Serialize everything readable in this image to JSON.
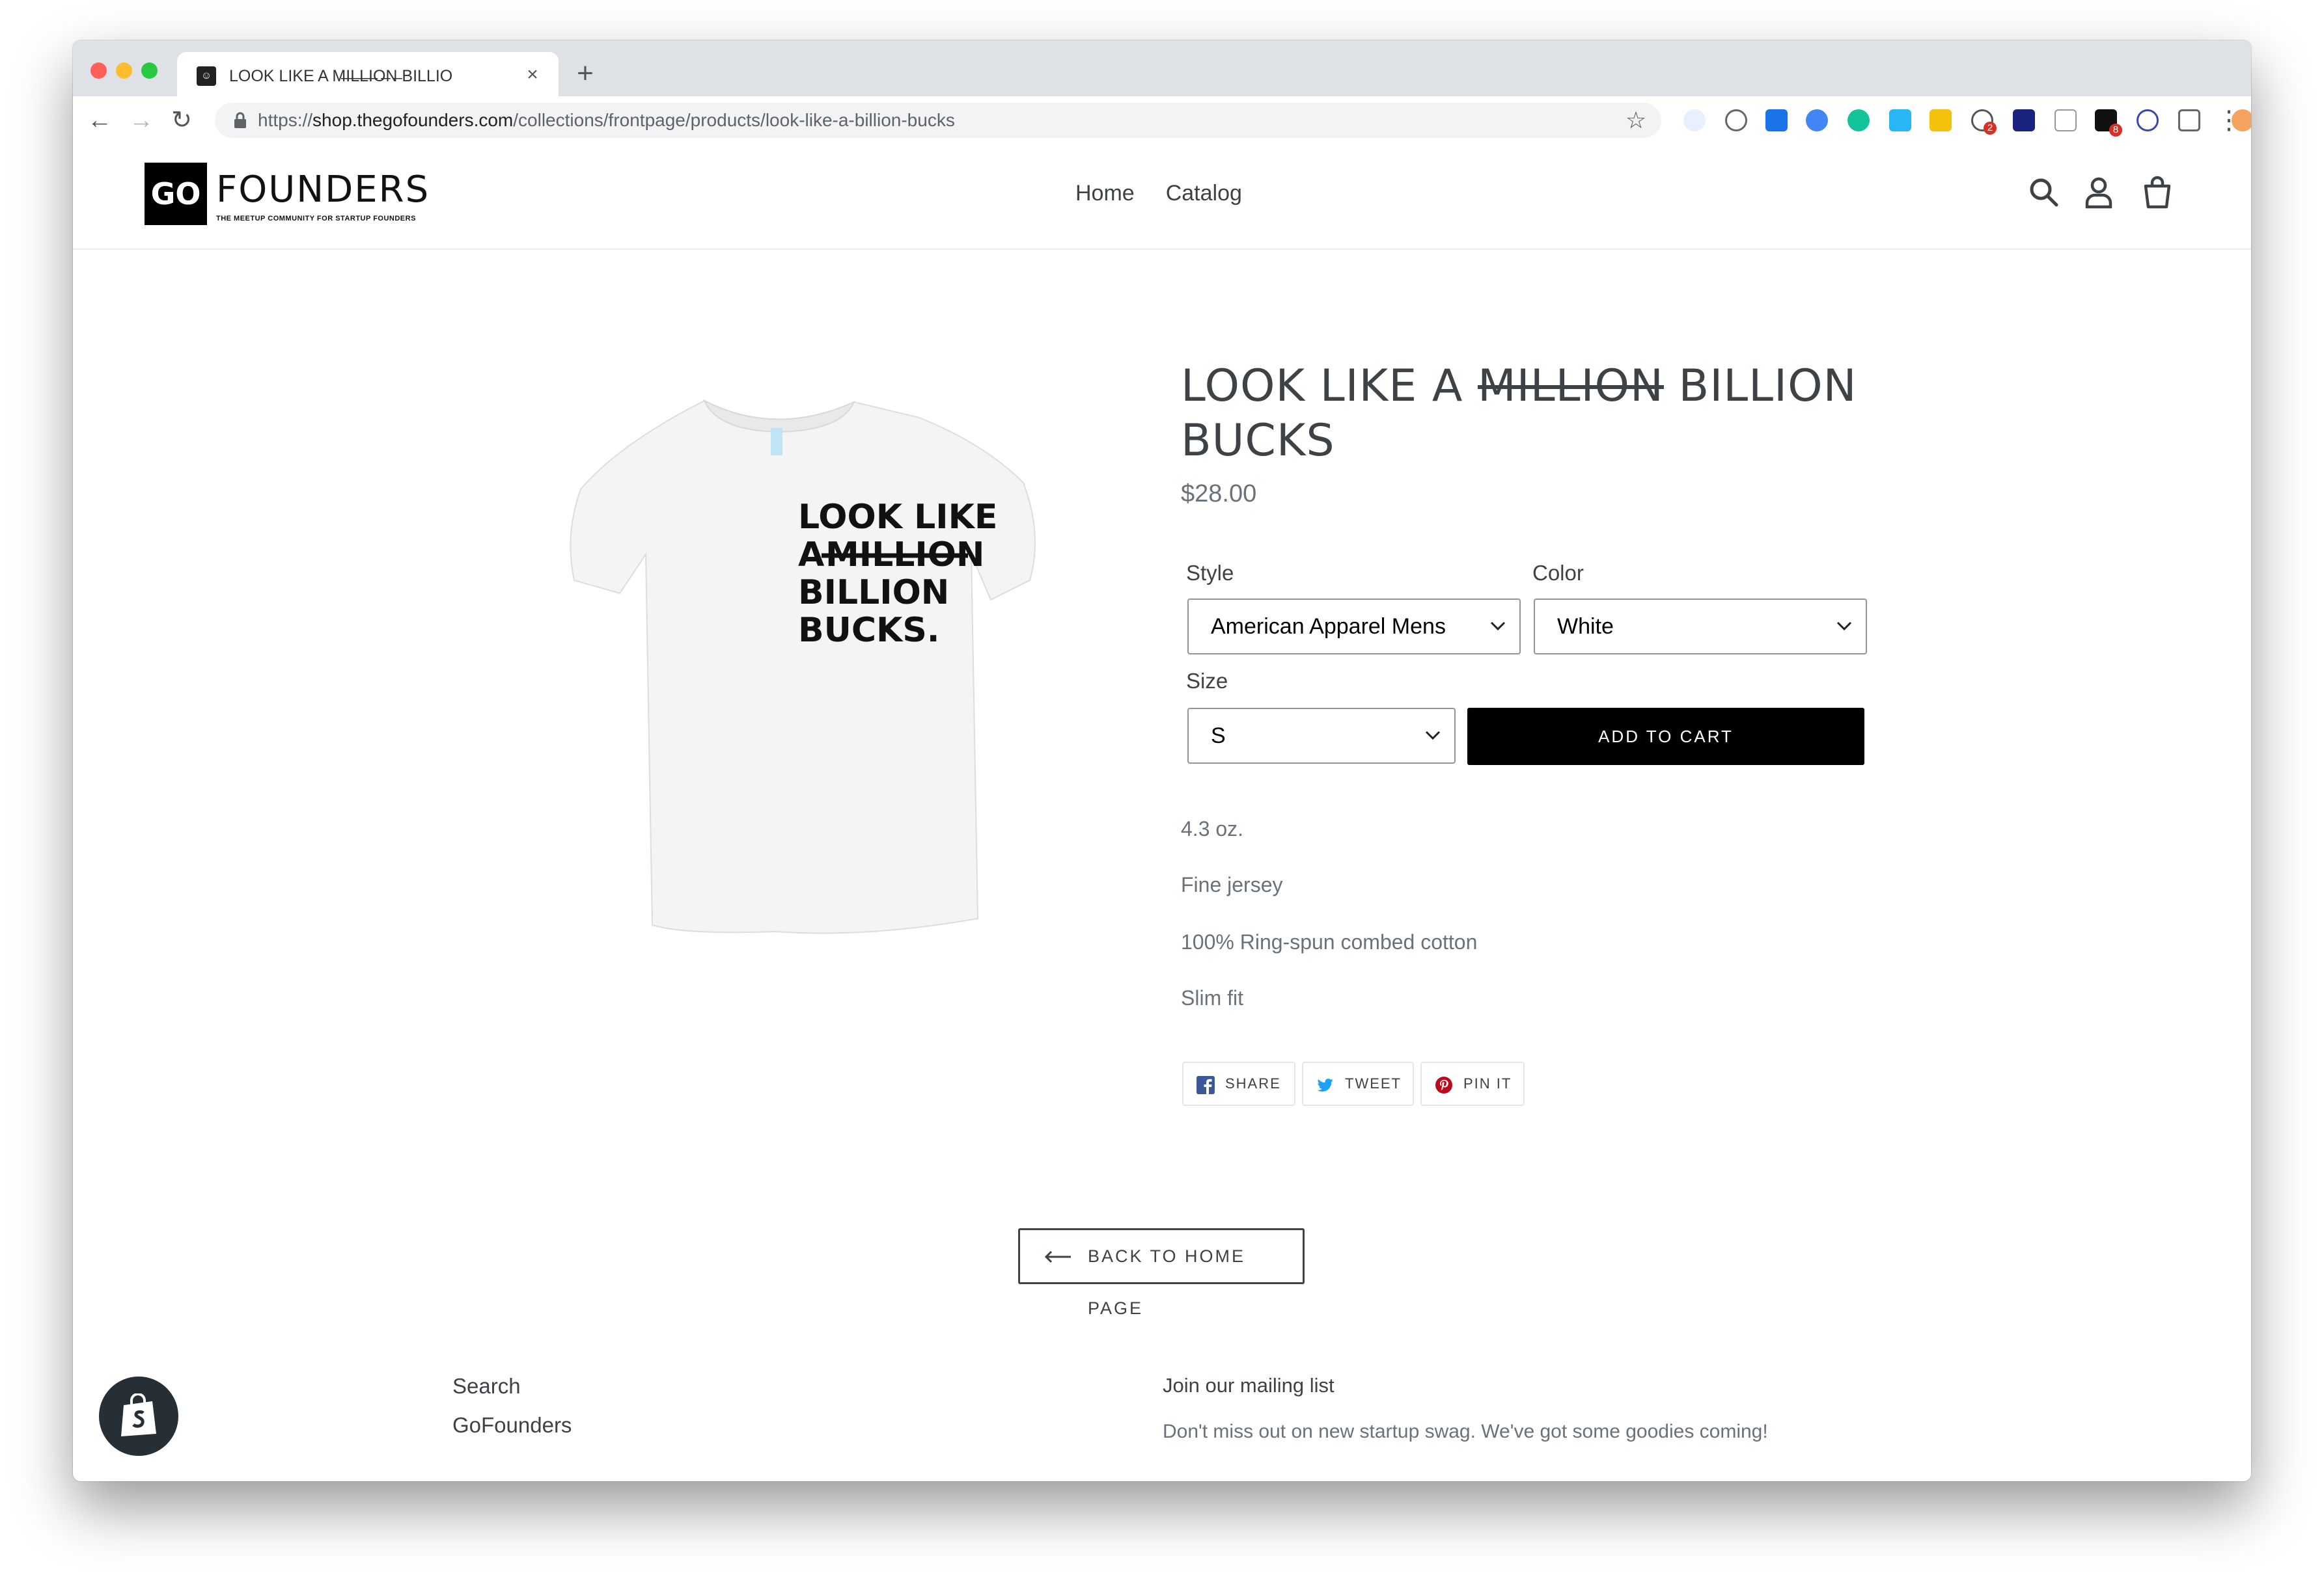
{
  "browser": {
    "tab_title": "LOOK LIKE A M̶I̶L̶L̶I̶O̶N̶ BILLIO",
    "tab_close": "×",
    "new_tab": "+",
    "url_scheme": "https://",
    "url_host": "shop.thegofounders.com",
    "url_path": "/collections/frontpage/products/look-like-a-billion-bucks",
    "extension_badges": [
      "2",
      "8"
    ]
  },
  "header": {
    "logo_go": "GO",
    "logo_word": "FOUNDERS",
    "logo_tagline": "THE MEETUP COMMUNITY FOR STARTUP FOUNDERS",
    "nav": [
      "Home",
      "Catalog"
    ]
  },
  "product": {
    "title_prefix": "LOOK LIKE A ",
    "title_strike": "MILLION",
    "title_suffix": " BILLION BUCKS",
    "price": "$28.00",
    "shirt_text": [
      "LOOK LIKE",
      "A",
      "MILLION",
      "BILLION",
      "BUCKS."
    ],
    "options": {
      "style_label": "Style",
      "style_value": "American Apparel Mens",
      "color_label": "Color",
      "color_value": "White",
      "size_label": "Size",
      "size_value": "S"
    },
    "add_to_cart": "ADD TO CART",
    "description": [
      "4.3 oz.",
      "Fine jersey",
      "100% Ring-spun combed cotton",
      "Slim fit"
    ],
    "share": {
      "facebook": "SHARE",
      "twitter": "TWEET",
      "pinterest": "PIN IT"
    },
    "back_home": "BACK TO HOME PAGE"
  },
  "footer": {
    "links": [
      "Search",
      "GoFounders"
    ],
    "mailing_heading": "Join our mailing list",
    "mailing_text": "Don't miss out on new startup swag. We've got some goodies coming!"
  },
  "colors": {
    "text_dark": "#3d4246",
    "text_muted": "#69727b",
    "button": "#000000",
    "facebook": "#3b5998",
    "twitter": "#1da1f2",
    "pinterest": "#bd081c"
  }
}
